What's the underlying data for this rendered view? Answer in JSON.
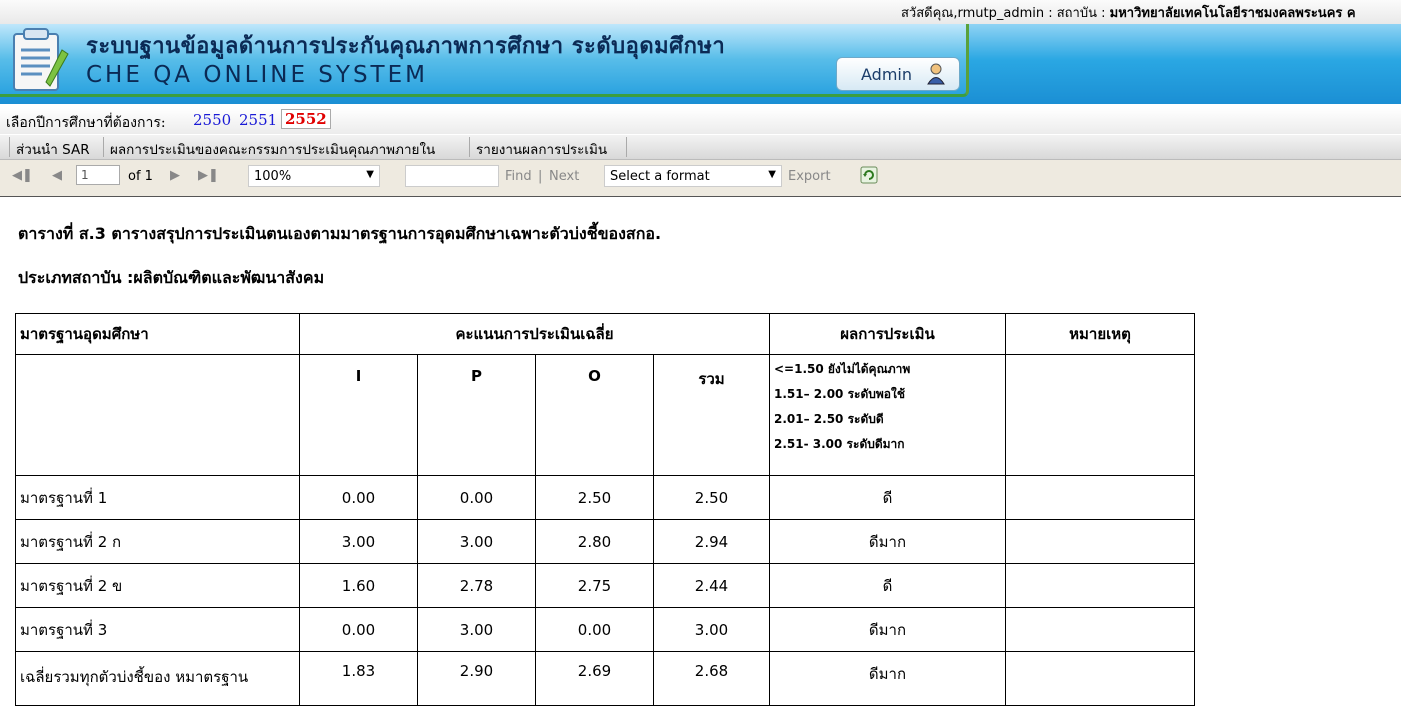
{
  "greeting": {
    "prefix": "สวัสดีคุณ,rmutp_admin : สถาบัน : ",
    "institution": "มหาวิทยาลัยเทคโนโลยีราชมงคลพระนคร ค"
  },
  "banner": {
    "title_th": "ระบบฐานข้อมูลด้านการประกันคุณภาพการศึกษา ระดับอุดมศึกษา",
    "title_en": "CHE QA ONLINE SYSTEM",
    "admin_label": "Admin",
    "logo_icon": "document-clipboard-icon",
    "admin_icon": "user-icon"
  },
  "year_selector": {
    "label": "เลือกปีการศึกษาที่ต้องการ:",
    "years": [
      "2550",
      "2551",
      "2552"
    ],
    "selected": "2552"
  },
  "tabs": [
    "ส่วนนำ SAR",
    "ผลการประเมินของคณะกรรมการประเมินคุณภาพภายใน",
    "รายงานผลการประเมิน"
  ],
  "toolbar": {
    "page_value": "1",
    "of_label": "of 1",
    "zoom": "100%",
    "find_value": "",
    "find_label": "Find",
    "separator": "|",
    "next_label": "Next",
    "format_select": "Select a format",
    "export_label": "Export"
  },
  "report": {
    "title": "ตารางที่ ส.3 ตารางสรุปการประเมินตนเองตามมาตรฐานการอุดมศึกษาเฉพาะตัวบ่งชี้ของสกอ.",
    "subtitle": "ประเภทสถาบัน :ผลิตบัณฑิตและพัฒนาสังคม",
    "headers": {
      "standard": "มาตรฐานอุดมศึกษา",
      "avg_score": "คะแนนการประเมินเฉลี่ย",
      "result": "ผลการประเมิน",
      "note": "หมายเหตุ"
    },
    "sub_headers": [
      "I",
      "P",
      "O",
      "รวม"
    ],
    "legend": [
      "<=1.50 ยังไม่ได้คุณภาพ",
      "1.51– 2.00 ระดับพอใช้",
      "2.01– 2.50 ระดับดี",
      "2.51- 3.00 ระดับดีมาก"
    ],
    "rows": [
      {
        "standard": "มาตรฐานที่ 1",
        "I": "0.00",
        "P": "0.00",
        "O": "2.50",
        "total": "2.50",
        "result": "ดี",
        "note": ""
      },
      {
        "standard": "มาตรฐานที่ 2 ก",
        "I": "3.00",
        "P": "3.00",
        "O": "2.80",
        "total": "2.94",
        "result": "ดีมาก",
        "note": ""
      },
      {
        "standard": "มาตรฐานที่ 2 ข",
        "I": "1.60",
        "P": "2.78",
        "O": "2.75",
        "total": "2.44",
        "result": "ดี",
        "note": ""
      },
      {
        "standard": "มาตรฐานที่ 3",
        "I": "0.00",
        "P": "3.00",
        "O": "0.00",
        "total": "3.00",
        "result": "ดีมาก",
        "note": ""
      },
      {
        "standard": "เฉลี่ยรวมทุกตัวบ่งชี้ของ หมาตรฐาน",
        "I": "1.83",
        "P": "2.90",
        "O": "2.69",
        "total": "2.68",
        "result": "ดีมาก",
        "note": ""
      }
    ]
  }
}
